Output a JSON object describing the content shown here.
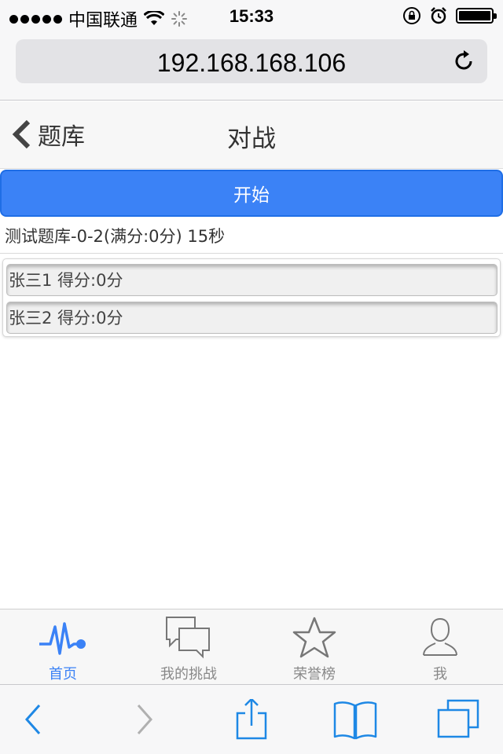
{
  "status_bar": {
    "carrier": "中国联通",
    "time": "15:33"
  },
  "browser": {
    "url": "192.168.168.106"
  },
  "header": {
    "back_label": "题库",
    "title": "对战"
  },
  "start_button": {
    "label": "开始"
  },
  "quiz_info": "测试题库-0-2(满分:0分) 15秒",
  "players": [
    {
      "text": "张三1 得分:0分"
    },
    {
      "text": "张三2 得分:0分"
    }
  ],
  "tabs": [
    {
      "label": "首页",
      "icon": "heartbeat-icon",
      "active": true
    },
    {
      "label": "我的挑战",
      "icon": "chat-bubbles-icon",
      "active": false
    },
    {
      "label": "荣誉榜",
      "icon": "star-icon",
      "active": false
    },
    {
      "label": "我",
      "icon": "user-icon",
      "active": false
    }
  ],
  "toolbar": {
    "icons": [
      "back-icon",
      "forward-icon",
      "share-icon",
      "bookmarks-icon",
      "tabs-icon"
    ]
  },
  "colors": {
    "accent": "#3b82f6",
    "tab_inactive": "#888888",
    "ios_blue": "#1e88e5"
  }
}
